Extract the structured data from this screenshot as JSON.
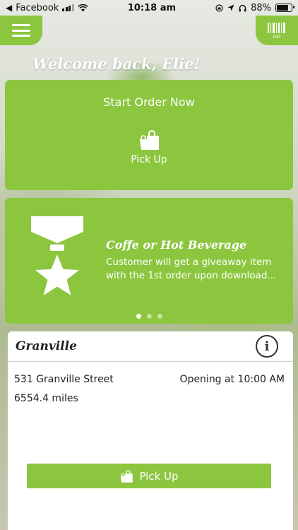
{
  "status_bar": {
    "back_app": "Facebook",
    "time": "10:18 am",
    "battery_percent": "88%",
    "battery_level": 0.88
  },
  "header": {
    "menu_icon": "hamburger-menu-icon",
    "barcode_icon": "barcode-icon",
    "barcode_digits": "032"
  },
  "welcome": "Welcome back, Elie!",
  "start_order": {
    "title": "Start Order Now",
    "pickup_label": "Pick Up",
    "pickup_icon": "shopping-bag-icon"
  },
  "promo": {
    "icon": "medal-star-icon",
    "title": "Coffe or Hot Beverage",
    "description": "Customer will get a giveaway item with the 1st order upon download...",
    "pages": 3,
    "active_page": 0
  },
  "store": {
    "name": "Granville",
    "info_icon": "info-icon",
    "address": "531 Granville Street",
    "opening": "Opening at 10:00 AM",
    "distance": "6554.4 miles",
    "pickup_label": "Pick Up"
  },
  "colors": {
    "accent": "#8cc63f",
    "text_dark": "#222222"
  }
}
